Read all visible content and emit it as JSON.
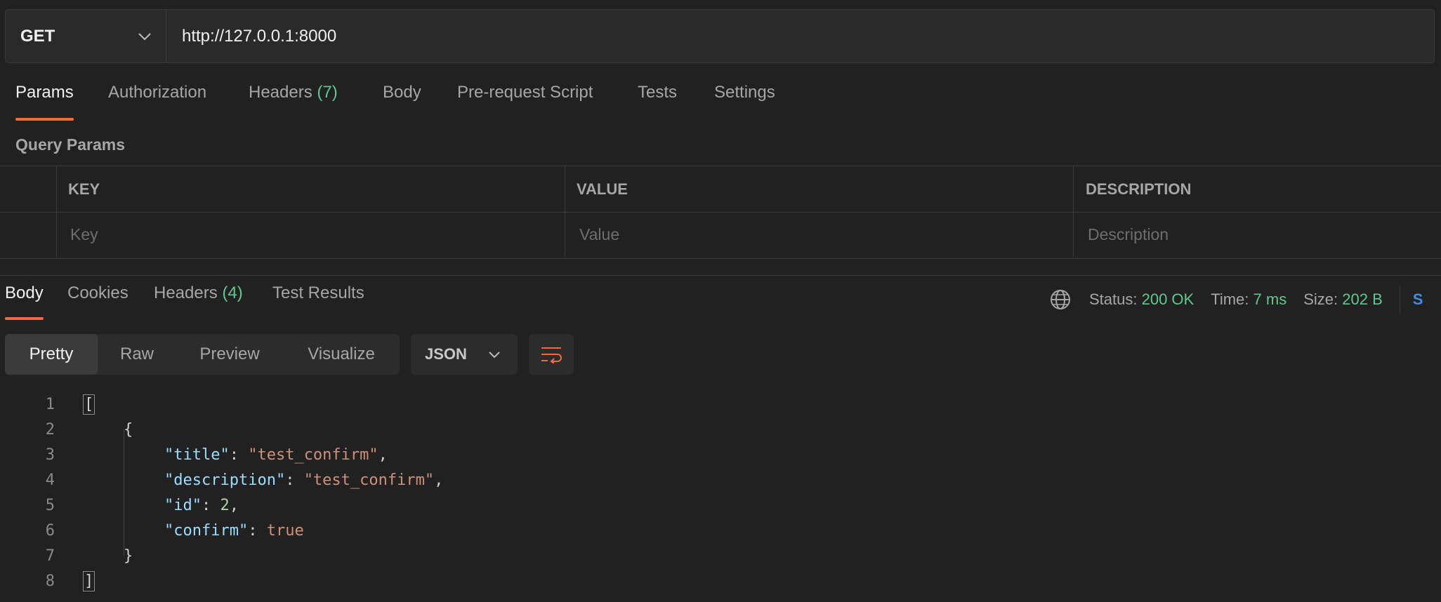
{
  "request": {
    "method": "GET",
    "url": "http://127.0.0.1:8000"
  },
  "request_tabs": [
    {
      "label": "Params",
      "active": true
    },
    {
      "label": "Authorization"
    },
    {
      "label": "Headers",
      "count": "(7)"
    },
    {
      "label": "Body"
    },
    {
      "label": "Pre-request Script"
    },
    {
      "label": "Tests"
    },
    {
      "label": "Settings"
    }
  ],
  "query_params": {
    "title": "Query Params",
    "columns": [
      "KEY",
      "VALUE",
      "DESCRIPTION"
    ],
    "placeholders": {
      "key": "Key",
      "value": "Value",
      "description": "Description"
    }
  },
  "response_tabs": [
    {
      "label": "Body",
      "active": true
    },
    {
      "label": "Cookies"
    },
    {
      "label": "Headers",
      "count": "(4)"
    },
    {
      "label": "Test Results"
    }
  ],
  "response_meta": {
    "status_label": "Status:",
    "status_value": "200 OK",
    "time_label": "Time:",
    "time_value": "7 ms",
    "size_label": "Size:",
    "size_value": "202 B",
    "save_partial": "S"
  },
  "view_modes": [
    "Pretty",
    "Raw",
    "Preview",
    "Visualize"
  ],
  "active_view_mode": "Pretty",
  "format": "JSON",
  "response_body": {
    "line_numbers": [
      "1",
      "2",
      "3",
      "4",
      "5",
      "6",
      "7",
      "8"
    ],
    "open_array": "[",
    "open_object": "{",
    "fields": [
      {
        "key": "\"title\"",
        "value": "\"test_confirm\"",
        "type": "string",
        "comma": ","
      },
      {
        "key": "\"description\"",
        "value": "\"test_confirm\"",
        "type": "string",
        "comma": ","
      },
      {
        "key": "\"id\"",
        "value": "2",
        "type": "number",
        "comma": ","
      },
      {
        "key": "\"confirm\"",
        "value": "true",
        "type": "bool",
        "comma": ""
      }
    ],
    "close_object": "}",
    "close_array": "]"
  },
  "colors": {
    "accent": "#f26b3a",
    "success": "#5ec98f",
    "json_key": "#9cdcfe",
    "json_string": "#ce9178",
    "link": "#3c8fe0"
  }
}
